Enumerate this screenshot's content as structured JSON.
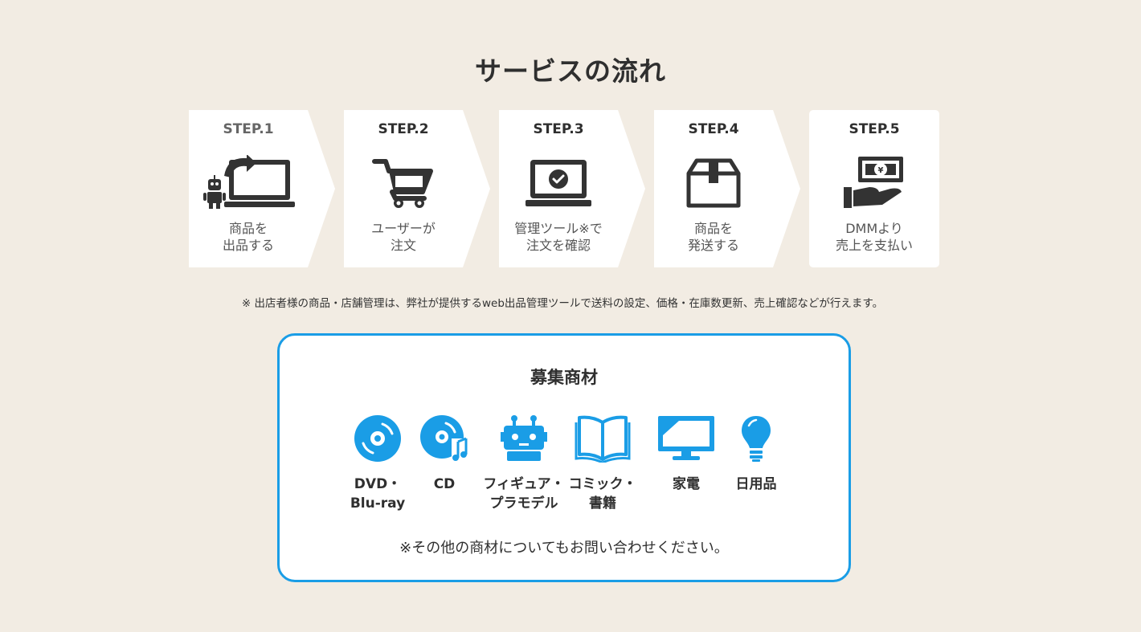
{
  "page_title": "サービスの流れ",
  "steps": [
    {
      "label": "STEP.1",
      "desc": "商品を\n出品する",
      "icon": "robot-laptop-icon"
    },
    {
      "label": "STEP.2",
      "desc": "ユーザーが\n注文",
      "icon": "shopping-cart-icon"
    },
    {
      "label": "STEP.3",
      "desc": "管理ツール※で\n注文を確認",
      "icon": "laptop-check-icon"
    },
    {
      "label": "STEP.4",
      "desc": "商品を\n発送する",
      "icon": "box-icon"
    },
    {
      "label": "STEP.5",
      "desc": "DMMより\n売上を支払い",
      "icon": "money-hand-icon"
    }
  ],
  "note": "※ 出店者様の商品・店舗管理は、弊社が提供するweb出品管理ツールで送料の設定、価格・在庫数更新、売上確認などが行えます。",
  "recruit": {
    "title": "募集商材",
    "categories": [
      {
        "label": "DVD・\nBlu-ray",
        "icon": "disc-icon"
      },
      {
        "label": "CD",
        "icon": "music-disc-icon"
      },
      {
        "label": "フィギュア・\nプラモデル",
        "icon": "robot-figure-icon"
      },
      {
        "label": "コミック・\n書籍",
        "icon": "book-icon"
      },
      {
        "label": "家電",
        "icon": "monitor-icon"
      },
      {
        "label": "日用品",
        "icon": "lightbulb-icon"
      }
    ],
    "note": "※その他の商材についてもお問い合わせください。"
  },
  "colors": {
    "background": "#f2ece3",
    "accent": "#1a9de6",
    "icon_dark": "#333333"
  }
}
